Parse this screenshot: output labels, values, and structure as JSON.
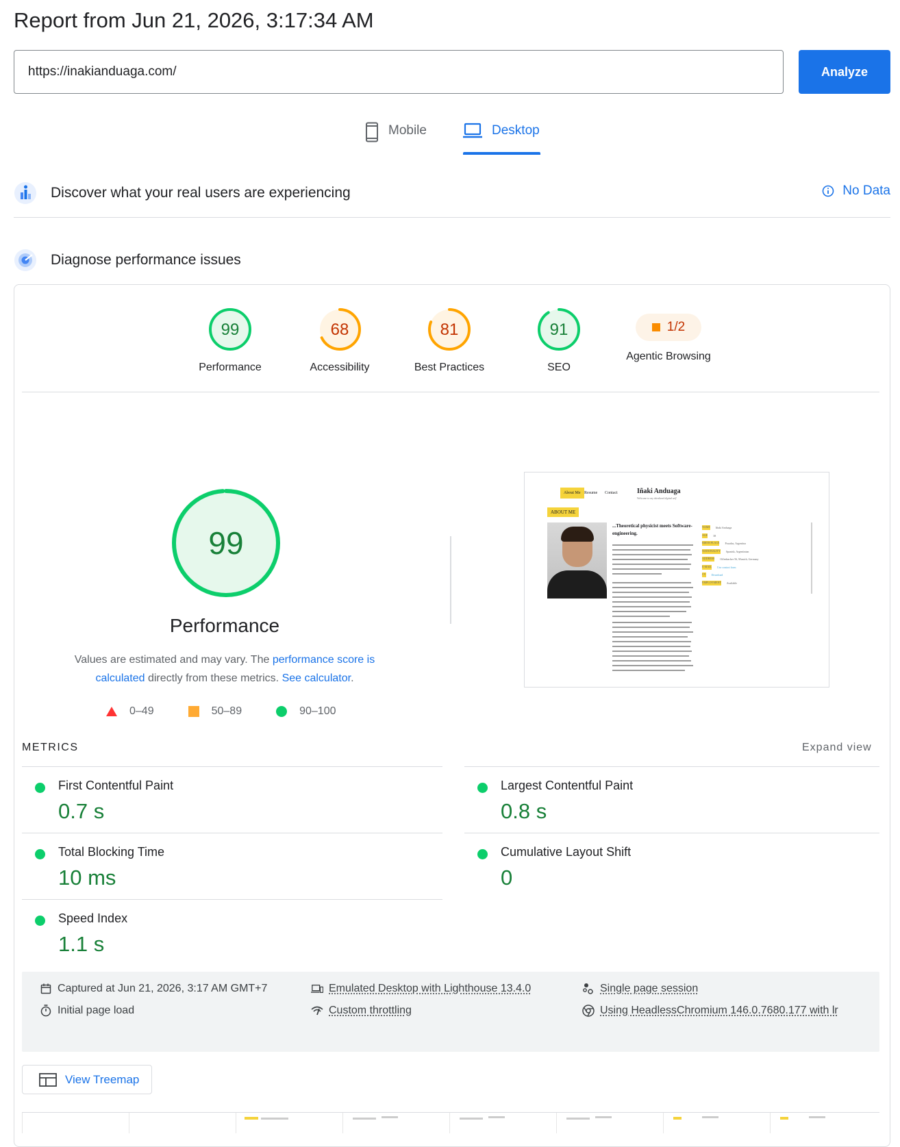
{
  "report": {
    "title": "Report from Jun 21, 2026, 3:17:34 AM",
    "url_value": "https://inakianduaga.com/",
    "analyze_label": "Analyze"
  },
  "device_tabs": [
    {
      "label": "Mobile",
      "icon": "phone-icon",
      "selected": false
    },
    {
      "label": "Desktop",
      "icon": "laptop-icon",
      "selected": true
    }
  ],
  "crux": {
    "title": "Discover what your real users are experiencing",
    "status": "No Data"
  },
  "diagnose": {
    "title": "Diagnose performance issues"
  },
  "categories": [
    {
      "label": "Performance",
      "score": "99",
      "value": 99,
      "rating": "pass"
    },
    {
      "label": "Accessibility",
      "score": "68",
      "value": 68,
      "rating": "average"
    },
    {
      "label": "Best Practices",
      "score": "81",
      "value": 81,
      "rating": "average"
    },
    {
      "label": "SEO",
      "score": "91",
      "value": 91,
      "rating": "pass"
    },
    {
      "label": "Agentic Browsing",
      "score": "1/2",
      "rating": "average"
    }
  ],
  "performance": {
    "score": "99",
    "value": 99,
    "title": "Performance",
    "note_prefix": "Values are estimated and may vary. The ",
    "note_link1": "performance score is calculated",
    "note_middle": " directly from these metrics. ",
    "note_link2": "See calculator",
    "note_suffix": ".",
    "legend": [
      {
        "range": "0–49",
        "shape": "triangle",
        "color": "#ff3333"
      },
      {
        "range": "50–89",
        "shape": "square",
        "color": "#ffaa33"
      },
      {
        "range": "90–100",
        "shape": "circle",
        "color": "#0cce6b"
      }
    ]
  },
  "preview": {
    "tabs": [
      "About Me",
      "Resume",
      "Contact"
    ],
    "name": "Iñaki Anduaga",
    "subtitle": "Welcome to my idealized digital self",
    "section": "ABOUT ME",
    "heading": "...Theoretical physicist meets Software-engineering.",
    "fields": [
      {
        "key": "NAME",
        "value": "Iñaki Anduaga"
      },
      {
        "key": "AGE",
        "value": "38"
      },
      {
        "key": "BIRTH PLACE",
        "value": "Posadas, Argentina"
      },
      {
        "key": "NATIONALITY",
        "value": "Spanish, Argentinian"
      },
      {
        "key": "ADDRESS",
        "value": "Offenbacher 56, Munich, Germany"
      },
      {
        "key": "E-MAIL",
        "value": "Use contact form"
      },
      {
        "key": "CV",
        "value": "Download"
      },
      {
        "key": "EMPLOYMENT",
        "value": "Available"
      }
    ]
  },
  "metrics": {
    "header": "METRICS",
    "expand_label": "Expand view",
    "items": [
      {
        "name": "First Contentful Paint",
        "value": "0.7 s",
        "rating": "pass"
      },
      {
        "name": "Largest Contentful Paint",
        "value": "0.8 s",
        "rating": "pass"
      },
      {
        "name": "Total Blocking Time",
        "value": "10 ms",
        "rating": "pass"
      },
      {
        "name": "Cumulative Layout Shift",
        "value": "0",
        "rating": "pass"
      },
      {
        "name": "Speed Index",
        "value": "1.1 s",
        "rating": "pass"
      }
    ]
  },
  "runtime": {
    "captured": "Captured at Jun 21, 2026, 3:17 AM GMT+7",
    "load": "Initial page load",
    "emulated": "Emulated Desktop with Lighthouse 13.4.0",
    "throttling": "Custom throttling",
    "session": "Single page session",
    "browser": "Using HeadlessChromium 146.0.7680.177 with lr"
  },
  "treemap": {
    "label": "View Treemap"
  },
  "colors": {
    "accent": "#1a73e8",
    "pass": "#0cce6b",
    "pass_text": "#188038",
    "average": "#ffa400",
    "average_text": "#c33300"
  }
}
